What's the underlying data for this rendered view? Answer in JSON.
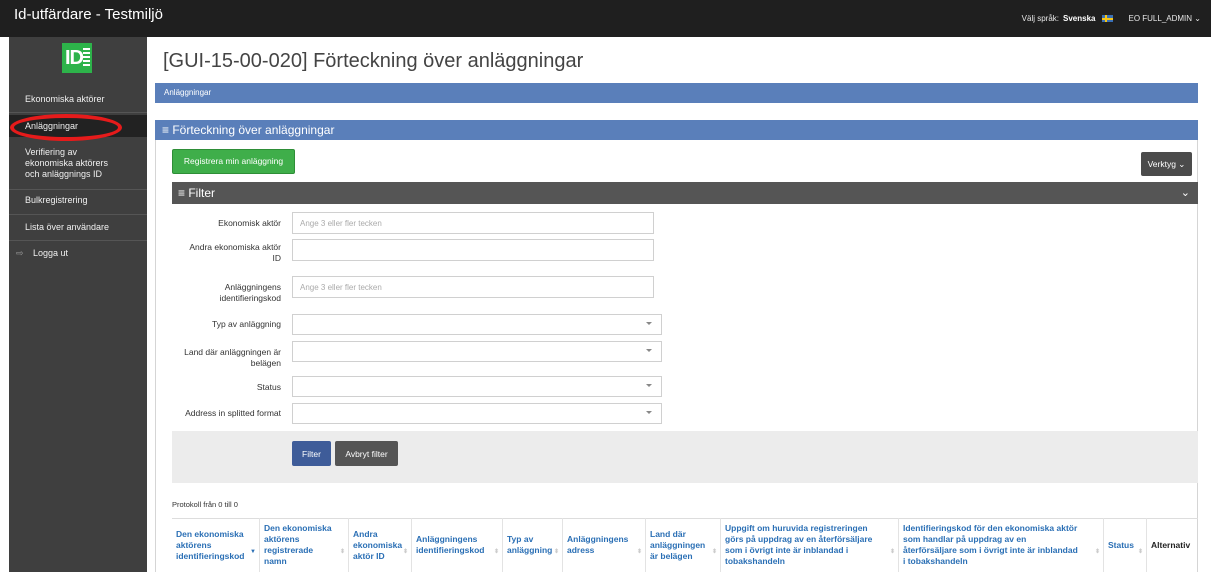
{
  "app": {
    "title": "Id-utfärdare - Testmiljö",
    "language_label": "Välj språk:",
    "language_value": "Svenska",
    "user": "EO FULL_ADMIN",
    "logo_text": "ID"
  },
  "sidebar": {
    "items": [
      {
        "label": "Ekonomiska aktörer"
      },
      {
        "label": "Anläggningar"
      },
      {
        "label_lines": [
          "Verifiering av",
          "ekonomiska aktörers",
          "och anläggnings ID"
        ]
      },
      {
        "label": "Bulkregistrering"
      },
      {
        "label": "Lista över användare"
      },
      {
        "label": "Logga ut"
      }
    ]
  },
  "page": {
    "title": "[GUI-15-00-020] Förteckning över anläggningar",
    "breadcrumb": "Anläggningar",
    "panel_title": "≡ Förteckning över anläggningar",
    "register_button": "Registrera min anläggning",
    "tools_button": "Verktyg ⌄"
  },
  "filter": {
    "title": "≡ Filter",
    "fields": {
      "economic_operator": {
        "label": "Ekonomisk aktör",
        "placeholder": "Ange 3 eller fler tecken",
        "value": ""
      },
      "other_eo_id": {
        "label_lines": [
          "Andra ekonomiska aktör",
          "ID"
        ],
        "value": ""
      },
      "facility_id": {
        "label_lines": [
          "Anläggningens",
          "identifieringskod"
        ],
        "placeholder": "Ange 3 eller fler tecken",
        "value": ""
      },
      "facility_type": {
        "label": "Typ av anläggning",
        "value": ""
      },
      "country": {
        "label_lines": [
          "Land där anläggningen är",
          "belägen"
        ],
        "value": ""
      },
      "status": {
        "label": "Status",
        "value": ""
      },
      "address_format": {
        "label": "Address in splitted format",
        "value": ""
      }
    },
    "filter_button": "Filter",
    "cancel_button": "Avbryt filter"
  },
  "table": {
    "records_info": "Protokoll från 0 till 0",
    "columns": [
      {
        "lines": [
          "Den ekonomiska",
          "aktörens",
          "identifieringskod"
        ]
      },
      {
        "lines": [
          "Den ekonomiska",
          "aktörens",
          "registrerade",
          "namn"
        ]
      },
      {
        "lines": [
          "Andra",
          "ekonomiska",
          "aktör ID"
        ]
      },
      {
        "lines": [
          "Anläggningens",
          "identifieringskod"
        ]
      },
      {
        "lines": [
          "Typ av",
          "anläggning"
        ]
      },
      {
        "lines": [
          "Anläggningens",
          "adress"
        ]
      },
      {
        "lines": [
          "Land där",
          "anläggningen",
          "är belägen"
        ]
      },
      {
        "lines": [
          "Uppgift om huruvida registreringen",
          "görs på uppdrag av en återförsäljare",
          "som i övrigt inte är inblandad i",
          "tobakshandeln"
        ]
      },
      {
        "lines": [
          "Identifieringskod för den ekonomiska aktör",
          "som handlar på uppdrag av en",
          "återförsäljare som i övrigt inte är inblandad",
          "i tobakshandeln"
        ]
      },
      {
        "lines": [
          "Status"
        ]
      },
      {
        "lines": [
          "Alternativ"
        ]
      }
    ]
  },
  "colors": {
    "navbar": "#1f1f1f",
    "sidebar": "#3f3f3f",
    "panel_header": "#5a7fba",
    "primary_button": "#3fae4a",
    "filter_button": "#3e5c99",
    "annotation_ring": "#e61b1b"
  }
}
